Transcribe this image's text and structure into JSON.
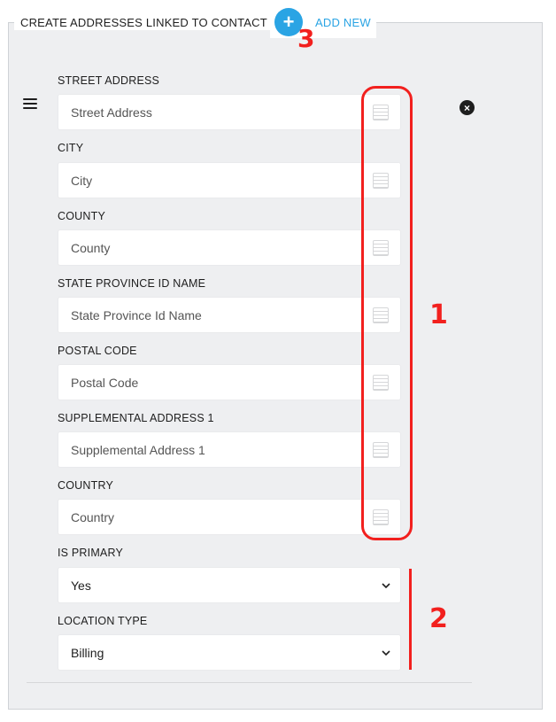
{
  "section": {
    "legend": "CREATE ADDRESSES LINKED TO CONTACT",
    "add_new_label": "ADD NEW",
    "add_icon": "+",
    "remove_icon": "×"
  },
  "fields": [
    {
      "label": "STREET ADDRESS",
      "placeholder": "Street Address"
    },
    {
      "label": "CITY",
      "placeholder": "City"
    },
    {
      "label": "COUNTY",
      "placeholder": "County"
    },
    {
      "label": "STATE PROVINCE ID NAME",
      "placeholder": "State Province Id Name"
    },
    {
      "label": "POSTAL CODE",
      "placeholder": "Postal Code"
    },
    {
      "label": "SUPPLEMENTAL ADDRESS 1",
      "placeholder": "Supplemental Address 1"
    },
    {
      "label": "COUNTRY",
      "placeholder": "Country"
    }
  ],
  "selects": [
    {
      "label": "IS PRIMARY",
      "value": "Yes"
    },
    {
      "label": "LOCATION TYPE",
      "value": "Billing"
    }
  ],
  "annotations": {
    "one": "1",
    "two": "2",
    "three": "3",
    "color": "#f2201e"
  },
  "colors": {
    "accent": "#2aa4e4",
    "panel_bg": "#eeeff1"
  }
}
